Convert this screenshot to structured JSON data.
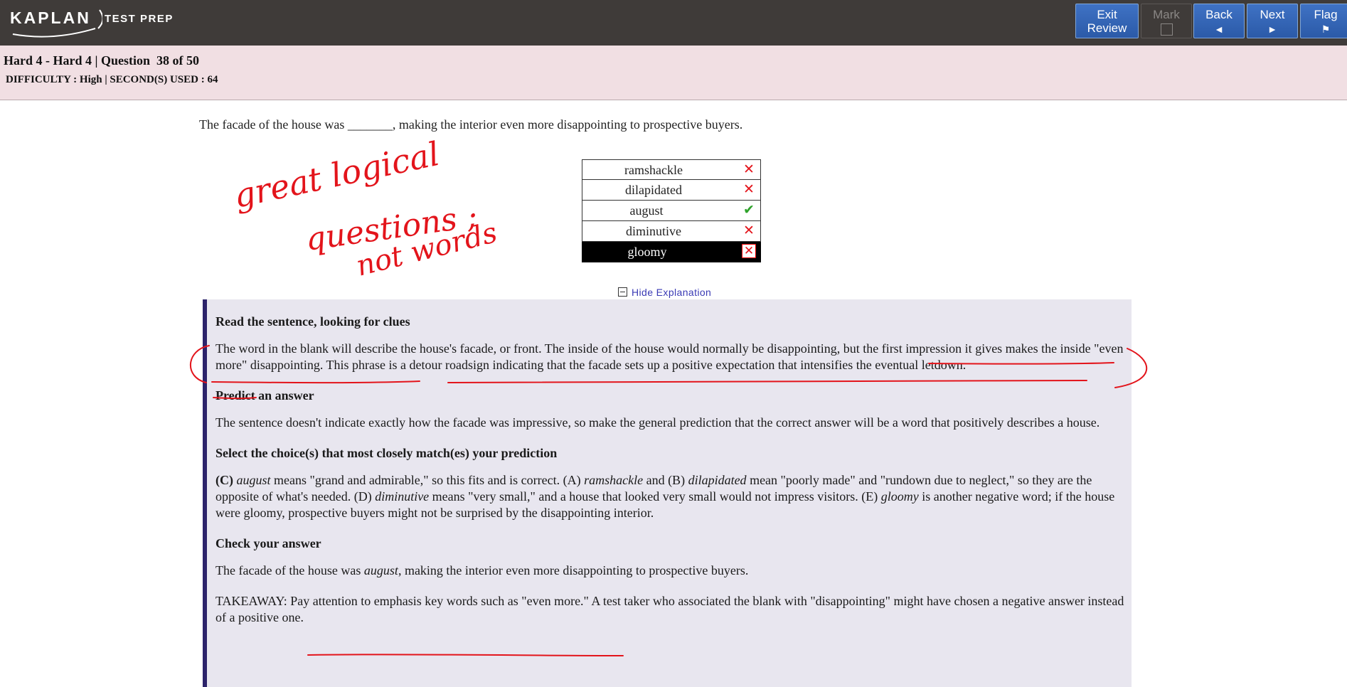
{
  "brand": {
    "logo": "KAPLAN",
    "sub": "TEST PREP"
  },
  "toolbar": {
    "exit": {
      "line1": "Exit",
      "line2": "Review"
    },
    "mark": {
      "label": "Mark"
    },
    "back": {
      "label": "Back",
      "arrow": "◄"
    },
    "next": {
      "label": "Next",
      "arrow": "►"
    },
    "flag": {
      "label": "Flag",
      "icon": "⚑"
    }
  },
  "header": {
    "title": "Hard 4 - Hard 4 | Question  38 of 50",
    "meta": "DIFFICULTY : High | SECOND(S) USED : 64"
  },
  "question": {
    "text": "The facade of the house was _______, making the interior even more disappointing to prospective buyers."
  },
  "choices": [
    {
      "label": "ramshackle",
      "mark": "✕",
      "status": "wrong"
    },
    {
      "label": "dilapidated",
      "mark": "✕",
      "status": "wrong"
    },
    {
      "label": "august",
      "mark": "✔",
      "status": "correct"
    },
    {
      "label": "diminutive",
      "mark": "✕",
      "status": "wrong"
    },
    {
      "label": "gloomy",
      "mark": "✕",
      "status": "selected-wrong"
    }
  ],
  "hide_explanation": "Hide Explanation",
  "explanation": {
    "h1": "Read the sentence, looking for clues",
    "p1": "The word in the blank will describe the house's facade, or front. The inside of the house would normally be disappointing, but the first impression it gives makes the inside \"even more\" disappointing. This phrase is a detour roadsign indicating that the facade sets up a positive expectation that intensifies the eventual letdown.",
    "h2": "Predict an answer",
    "p2": "The sentence doesn't indicate exactly how the facade was impressive, so make the general prediction that the correct answer will be a word that positively describes a house.",
    "h3": "Select the choice(s) that most closely match(es) your prediction",
    "p3": {
      "c_label": "(C)",
      "c_word": "august",
      "t1": " means \"grand and admirable,\" so this fits and is correct. (A) ",
      "a_word": "ramshackle",
      "t2": " and (B) ",
      "b_word": "dilapidated",
      "t3": " mean \"poorly made\" and \"rundown due to neglect,\" so they are the opposite of what's needed. (D) ",
      "d_word": "diminutive",
      "t4": " means \"very small,\" and a house that looked very small would not impress visitors. (E) ",
      "e_word": "gloomy",
      "t5": " is another negative word; if the house were gloomy, prospective buyers might not be surprised by the disappointing interior."
    },
    "h4": "Check your answer",
    "p4": {
      "t1": "The facade of the house was ",
      "word": "august",
      "t2": ", making the interior even more disappointing to prospective buyers."
    },
    "p5": "TAKEAWAY: Pay attention to emphasis key words such as \"even more.\" A test taker who associated the blank with \"disappointing\" might have chosen a negative answer instead of a positive one."
  },
  "handwriting": {
    "line1": "great logical",
    "line2": "questions ;",
    "line3": "not words"
  },
  "colors": {
    "topbar": "#3f3b39",
    "header_band": "#f1dfe3",
    "explanation_bg": "#e8e6ef",
    "explanation_border": "#2c236a",
    "annotation": "#e3141b",
    "correct": "#2fa32b"
  }
}
